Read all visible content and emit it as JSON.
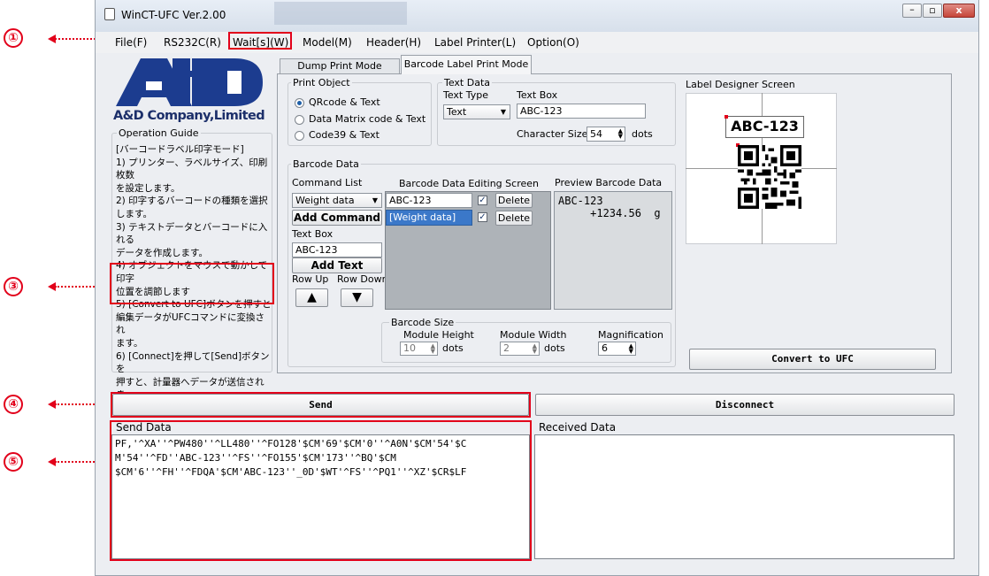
{
  "window": {
    "title": "WinCT-UFC  Ver.2.00"
  },
  "menu": [
    "File(F)",
    "RS232C(R)",
    "Wait[s](W)",
    "Model(M)",
    "Header(H)",
    "Label Printer(L)",
    "Option(O)"
  ],
  "callouts": [
    "①",
    "③",
    "④",
    "⑤"
  ],
  "logo": {
    "mark": "A&D",
    "company": "A&D Company,Limited"
  },
  "guide": {
    "title": "Operation Guide",
    "lines": [
      "[バーコードラベル印字モード]",
      "1) プリンター、ラベルサイズ、印刷枚数",
      "を設定します。",
      "2) 印字するバーコードの種類を選択",
      "します。",
      "3) テキストデータとバーコードに入れる",
      "データを作成します。",
      "4) オブジェクトをマウスで動かして印字",
      "位置を調節します",
      "5) [Convert to UFC]ボタンを押すと",
      "編集データがUFCコマンドに変換され",
      "ます。",
      "6) [Connect]を押して[Send]ボタンを",
      "押すと、計量器へデータが送信されま",
      "す。"
    ]
  },
  "tabs": [
    "Dump Print Mode",
    "Barcode Label Print Mode"
  ],
  "print_object": {
    "title": "Print Object",
    "options": [
      "QRcode  &  Text",
      "Data Matrix code  &  Text",
      "Code39  &  Text"
    ],
    "selected": 0
  },
  "text_data": {
    "title": "Text Data",
    "type_label": "Text Type",
    "type_value": "Text",
    "box_label": "Text Box",
    "box_value": "ABC-123",
    "size_label": "Character Size",
    "size_value": "54",
    "size_unit": "dots"
  },
  "barcode_data": {
    "title": "Barcode Data",
    "command_list_label": "Command List",
    "command_value": "Weight data",
    "add_command": "Add Command",
    "text_box_label": "Text Box",
    "text_box_value": "ABC-123",
    "add_text": "Add Text",
    "row_up": "Row Up",
    "row_down": "Row Down",
    "editing_title": "Barcode Data Editing Screen",
    "rows": [
      {
        "text": "ABC-123",
        "checked": "✓",
        "action": "Delete"
      },
      {
        "text": "[Weight data]",
        "checked": "✓",
        "action": "Delete"
      }
    ],
    "preview_title": "Preview Barcode Data",
    "preview_lines": [
      "ABC-123",
      "     +1234.56  g"
    ]
  },
  "barcode_size": {
    "title": "Barcode Size",
    "height_label": "Module Height",
    "height_value": "10",
    "width_label": "Module Width",
    "width_value": "2",
    "unit": "dots",
    "mag_label": "Magnification",
    "mag_value": "6"
  },
  "designer": {
    "title": "Label Designer Screen",
    "label_text": "ABC-123"
  },
  "convert_button": "Convert to UFC",
  "send_button": "Send",
  "disconnect_button": "Disconnect",
  "send_data": {
    "title": "Send Data",
    "lines": [
      "PF,'^XA''^PW480''^LL480''^FO128'$CM'69'$CM'0''^A0N'$CM'54'$C",
      "M'54''^FD''ABC-123''^FS''^FO155'$CM'173''^BQ'$CM",
      "$CM'6''^FH''^FDQA'$CM'ABC-123''_0D'$WT'^FS''^PQ1''^XZ'$CR$LF"
    ]
  },
  "received_data": {
    "title": "Received Data"
  },
  "colors": {
    "accent": "#e2001a",
    "logo": "#1c3c8f",
    "selection": "#3b78c9"
  }
}
